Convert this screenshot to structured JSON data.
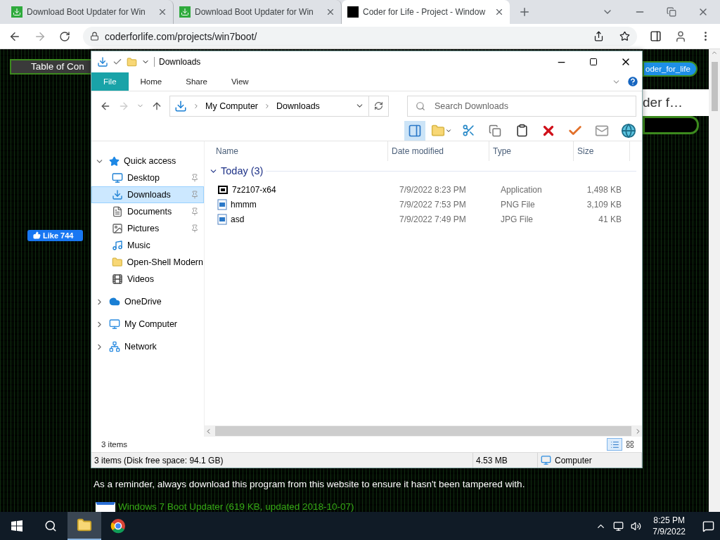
{
  "browser": {
    "tabs": [
      {
        "title": "Download Boot Updater for Win",
        "kind": "download",
        "selected": false
      },
      {
        "title": "Download Boot Updater for Win",
        "kind": "download",
        "selected": false
      },
      {
        "title": "Coder for Life - Project - Window",
        "kind": "site",
        "selected": true
      }
    ],
    "url": "coderforlife.com/projects/win7boot/"
  },
  "page": {
    "toc_button": "Table of Con",
    "like_button": "Like 744",
    "user_button": "oder_for_life",
    "card_title": "der f…",
    "reminder": "As a reminder, always download this program from this website to ensure it hasn't been tampered with.",
    "download_link": "Windows 7 Boot Updater (619 KB, updated 2018-10-07)"
  },
  "explorer": {
    "title": "Downloads",
    "ribbon_tabs": [
      {
        "label": "File",
        "selected": true
      },
      {
        "label": "Home",
        "selected": false
      },
      {
        "label": "Share",
        "selected": false
      },
      {
        "label": "View",
        "selected": false
      }
    ],
    "breadcrumb": [
      "My Computer",
      "Downloads"
    ],
    "search": {
      "placeholder": "Search Downloads"
    },
    "nav": [
      {
        "label": "Quick access",
        "kind": "star",
        "expanded": true,
        "selected": false,
        "children": [
          {
            "label": "Desktop",
            "kind": "desktop",
            "pinned": true,
            "selected": false
          },
          {
            "label": "Downloads",
            "kind": "download",
            "pinned": true,
            "selected": true
          },
          {
            "label": "Documents",
            "kind": "document",
            "pinned": true,
            "selected": false
          },
          {
            "label": "Pictures",
            "kind": "picture",
            "pinned": true,
            "selected": false
          },
          {
            "label": "Music",
            "kind": "music",
            "pinned": false,
            "selected": false
          },
          {
            "label": "Open-Shell Modern",
            "kind": "folder",
            "pinned": false,
            "selected": false
          },
          {
            "label": "Videos",
            "kind": "video",
            "pinned": false,
            "selected": false
          }
        ]
      },
      {
        "label": "OneDrive",
        "kind": "cloud",
        "expanded": false,
        "selected": false
      },
      {
        "label": "My Computer",
        "kind": "computer",
        "expanded": false,
        "selected": false
      },
      {
        "label": "Network",
        "kind": "network",
        "expanded": false,
        "selected": false
      }
    ],
    "columns": [
      "Name",
      "Date modified",
      "Type",
      "Size"
    ],
    "group": "Today (3)",
    "files": [
      {
        "name": "7z2107-x64",
        "date": "7/9/2022 8:23 PM",
        "type": "Application",
        "size": "1,498 KB",
        "kind": "app"
      },
      {
        "name": "hmmm",
        "date": "7/9/2022 7:53 PM",
        "type": "PNG File",
        "size": "3,109 KB",
        "kind": "image"
      },
      {
        "name": "asd",
        "date": "7/9/2022 7:49 PM",
        "type": "JPG File",
        "size": "41 KB",
        "kind": "image"
      }
    ],
    "item_count": "3 items",
    "status": {
      "summary": "3 items (Disk free space: 94.1 GB)",
      "size": "4.53 MB",
      "location": "Computer"
    }
  },
  "taskbar": {
    "apps": [
      {
        "kind": "explorer",
        "selected": true
      },
      {
        "kind": "chrome",
        "selected": false
      }
    ],
    "time": "8:25 PM",
    "date": "7/9/2022"
  }
}
